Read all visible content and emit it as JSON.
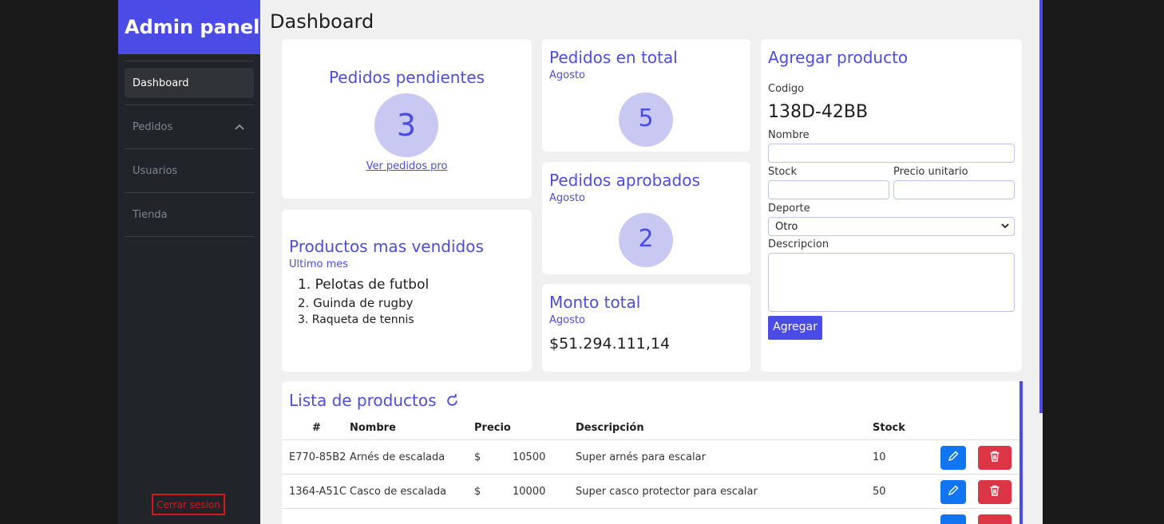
{
  "sidebar": {
    "brand": "Admin panel",
    "items": [
      {
        "label": "Dashboard",
        "active": true
      },
      {
        "label": "Pedidos",
        "icon": "chevron-up-icon"
      },
      {
        "label": "Usuarios"
      },
      {
        "label": "Tienda"
      }
    ],
    "logout_label": "Cerrar sesion"
  },
  "header": {
    "title": "Dashboard"
  },
  "cards": {
    "pending": {
      "title": "Pedidos pendientes",
      "value": "3",
      "link": "Ver pedidos pro"
    },
    "total": {
      "title": "Pedidos en total",
      "subtitle": "Agosto",
      "value": "5"
    },
    "approved": {
      "title": "Pedidos aprobados",
      "subtitle": "Agosto",
      "value": "2"
    },
    "amount": {
      "title": "Monto total",
      "subtitle": "Agosto",
      "value": "$51.294.111,14"
    },
    "top_products": {
      "title": "Productos mas vendidos",
      "subtitle": "Ultimo mes",
      "items": [
        "1. Pelotas de futbol",
        "2. Guinda de rugby",
        "3. Raqueta de tennis"
      ]
    }
  },
  "form": {
    "title": "Agregar producto",
    "code_label": "Codigo",
    "code_value": "138D-42BB",
    "name_label": "Nombre",
    "stock_label": "Stock",
    "price_label": "Precio unitario",
    "sport_label": "Deporte",
    "sport_value": "Otro",
    "desc_label": "Descripcion",
    "submit_label": "Agregar"
  },
  "products": {
    "title": "Lista de productos",
    "refresh_icon": "refresh-icon",
    "headers": [
      "#",
      "Nombre",
      "Precio",
      "Descripción",
      "Stock"
    ],
    "rows": [
      {
        "id": "E770-85B2",
        "name": "Arnés de escalada",
        "currency": "$",
        "price": "10500",
        "desc": "Super arnés para escalar",
        "stock": "10"
      },
      {
        "id": "1364-A51C",
        "name": "Casco de escalada",
        "currency": "$",
        "price": "10000",
        "desc": "Super casco protector para escalar",
        "stock": "50"
      }
    ]
  },
  "colors": {
    "accent": "#4b4ce6",
    "circle": "#c8c8f3",
    "sidebar": "#212529",
    "edit": "#1174f0",
    "delete": "#dc3545"
  }
}
